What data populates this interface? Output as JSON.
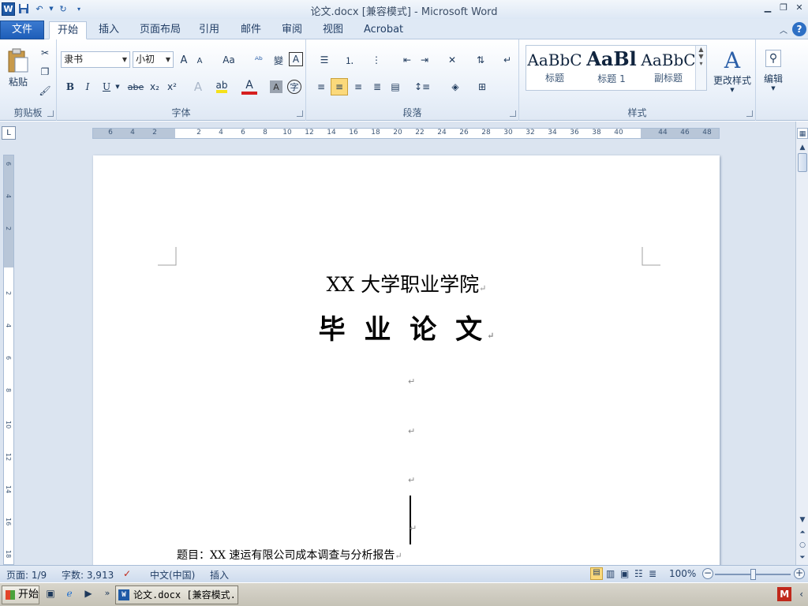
{
  "titlebar": {
    "title": "论文.docx [兼容模式] - Microsoft Word",
    "app_icon": "W"
  },
  "tabs": [
    {
      "label": "文件"
    },
    {
      "label": "开始"
    },
    {
      "label": "插入"
    },
    {
      "label": "页面布局"
    },
    {
      "label": "引用"
    },
    {
      "label": "邮件"
    },
    {
      "label": "审阅"
    },
    {
      "label": "视图"
    },
    {
      "label": "Acrobat"
    }
  ],
  "ribbon": {
    "clipboard": {
      "label": "剪贴板",
      "paste": "粘贴"
    },
    "font": {
      "label": "字体",
      "font_name": "隶书",
      "font_size": "小初",
      "bold": "B",
      "italic": "I",
      "underline": "U",
      "strike": "abe",
      "sub": "x₂",
      "sup": "x²",
      "grow": "A",
      "shrink": "A",
      "case": "Aa",
      "font_color": "A",
      "char_border": "A"
    },
    "paragraph": {
      "label": "段落"
    },
    "styles": {
      "label": "样式",
      "items": [
        {
          "preview": "AaBbC",
          "caption": "标题"
        },
        {
          "preview": "AaBl",
          "caption": "标题 1"
        },
        {
          "preview": "AaBbC",
          "caption": "副标题"
        }
      ],
      "change": "更改样式"
    },
    "editing": {
      "label": "编辑"
    }
  },
  "ruler": {
    "labels": [
      "6",
      "4",
      "2",
      "",
      "2",
      "4",
      "6",
      "8",
      "10",
      "12",
      "14",
      "16",
      "18",
      "20",
      "22",
      "24",
      "26",
      "28",
      "30",
      "32",
      "34",
      "36",
      "38",
      "40",
      "",
      "44",
      "46",
      "48"
    ],
    "vertical_labels": [
      "6",
      "4",
      "2",
      "",
      "2",
      "4",
      "6",
      "8",
      "10",
      "12",
      "14",
      "16",
      "18"
    ]
  },
  "document": {
    "school": "XX 大学职业学院",
    "title": "毕 业 论 文",
    "para_mark": "↵",
    "topic": "题目：XX 速运有限公司成本调查与分析报告"
  },
  "statusbar": {
    "page": "页面: 1/9",
    "words": "字数: 3,913",
    "language": "中文(中国)",
    "mode": "插入",
    "zoom": "100%"
  },
  "taskbar": {
    "start": "开始",
    "task_item": "论文.docx [兼容模式..."
  },
  "colors": {
    "accent": "#1f5aa6",
    "ribbon_bg": "#e9f0f9",
    "doc_bg": "#dbe4f0"
  }
}
